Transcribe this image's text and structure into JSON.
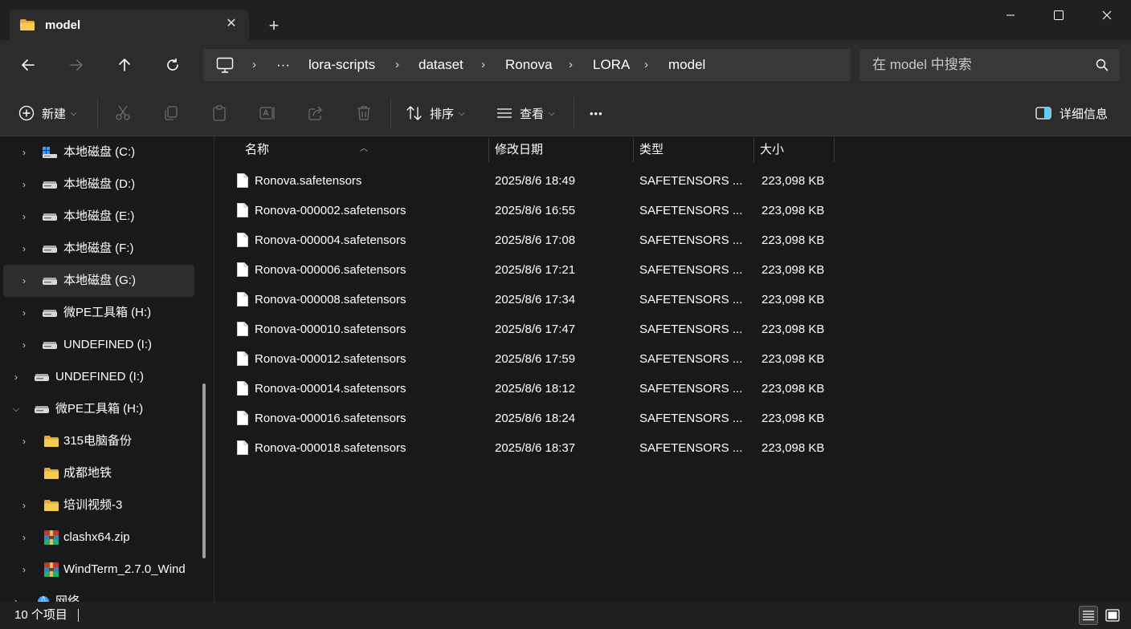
{
  "window": {
    "tab_title": "model",
    "new_tab": "+",
    "close_tab": "✕"
  },
  "breadcrumb": {
    "overflow": "···",
    "items": [
      "lora-scripts",
      "dataset",
      "Ronova",
      "LORA",
      "model"
    ],
    "separator": "›"
  },
  "search": {
    "placeholder": "在 model 中搜索"
  },
  "toolbar": {
    "new_label": "新建",
    "sort_label": "排序",
    "view_label": "查看",
    "more_label": "•••",
    "details_label": "详细信息"
  },
  "sidebar": {
    "items": [
      {
        "label": "本地磁盘 (C:)",
        "icon": "windows-drive-icon"
      },
      {
        "label": "本地磁盘 (D:)",
        "icon": "drive-icon"
      },
      {
        "label": "本地磁盘 (E:)",
        "icon": "drive-icon"
      },
      {
        "label": "本地磁盘 (F:)",
        "icon": "drive-icon"
      },
      {
        "label": "本地磁盘 (G:)",
        "icon": "drive-icon",
        "selected": true
      },
      {
        "label": "微PE工具箱 (H:)",
        "icon": "drive-icon"
      },
      {
        "label": "UNDEFINED (I:)",
        "icon": "drive-icon"
      },
      {
        "label": "UNDEFINED (I:)",
        "icon": "drive-icon"
      },
      {
        "label": "微PE工具箱 (H:)",
        "icon": "drive-icon",
        "expanded": true
      },
      {
        "label": "315电脑备份",
        "icon": "folder-icon"
      },
      {
        "label": "成都地铁",
        "icon": "folder-icon"
      },
      {
        "label": "培训视频-3",
        "icon": "folder-icon"
      },
      {
        "label": "clashx64.zip",
        "icon": "archive-icon"
      },
      {
        "label": "WindTerm_2.7.0_Wind",
        "icon": "archive-icon"
      },
      {
        "label": "网络",
        "icon": "network-icon"
      }
    ]
  },
  "columns": {
    "name": "名称",
    "modified": "修改日期",
    "type": "类型",
    "size": "大小"
  },
  "files": [
    {
      "name": "Ronova.safetensors",
      "modified": "2025/8/6 18:49",
      "type": "SAFETENSORS ...",
      "size": "223,098 KB"
    },
    {
      "name": "Ronova-000002.safetensors",
      "modified": "2025/8/6 16:55",
      "type": "SAFETENSORS ...",
      "size": "223,098 KB"
    },
    {
      "name": "Ronova-000004.safetensors",
      "modified": "2025/8/6 17:08",
      "type": "SAFETENSORS ...",
      "size": "223,098 KB"
    },
    {
      "name": "Ronova-000006.safetensors",
      "modified": "2025/8/6 17:21",
      "type": "SAFETENSORS ...",
      "size": "223,098 KB"
    },
    {
      "name": "Ronova-000008.safetensors",
      "modified": "2025/8/6 17:34",
      "type": "SAFETENSORS ...",
      "size": "223,098 KB"
    },
    {
      "name": "Ronova-000010.safetensors",
      "modified": "2025/8/6 17:47",
      "type": "SAFETENSORS ...",
      "size": "223,098 KB"
    },
    {
      "name": "Ronova-000012.safetensors",
      "modified": "2025/8/6 17:59",
      "type": "SAFETENSORS ...",
      "size": "223,098 KB"
    },
    {
      "name": "Ronova-000014.safetensors",
      "modified": "2025/8/6 18:12",
      "type": "SAFETENSORS ...",
      "size": "223,098 KB"
    },
    {
      "name": "Ronova-000016.safetensors",
      "modified": "2025/8/6 18:24",
      "type": "SAFETENSORS ...",
      "size": "223,098 KB"
    },
    {
      "name": "Ronova-000018.safetensors",
      "modified": "2025/8/6 18:37",
      "type": "SAFETENSORS ...",
      "size": "223,098 KB"
    }
  ],
  "status": {
    "item_count": "10 个项目"
  },
  "colors": {
    "folder": "#f6c343",
    "accent": "#60cdff"
  }
}
